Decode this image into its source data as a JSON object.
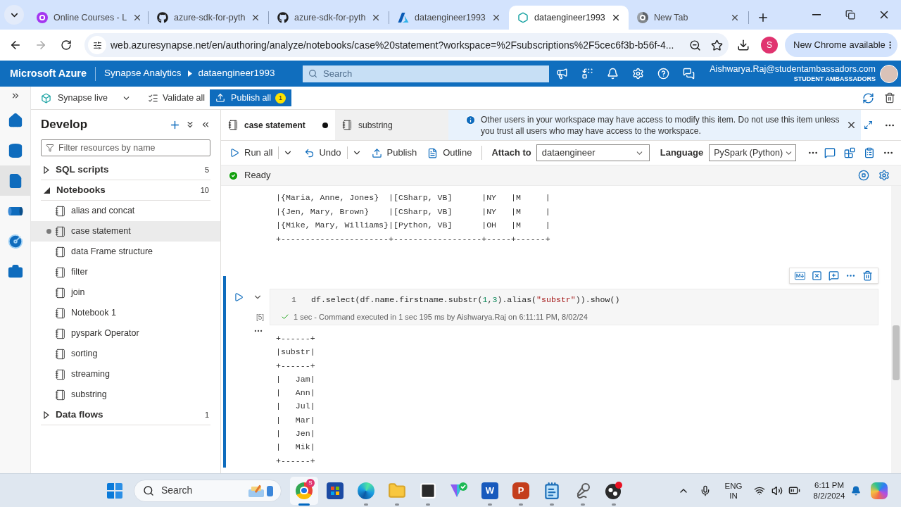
{
  "browser": {
    "tabs": [
      {
        "kind": "courses",
        "title": "Online Courses - L",
        "selected": false
      },
      {
        "kind": "github",
        "title": "azure-sdk-for-pyth",
        "selected": false
      },
      {
        "kind": "github",
        "title": "azure-sdk-for-pyth",
        "selected": false
      },
      {
        "kind": "azure",
        "title": "dataengineer1993",
        "selected": false
      },
      {
        "kind": "synapse",
        "title": "dataengineer1993",
        "selected": true
      },
      {
        "kind": "newtab",
        "title": "New Tab",
        "selected": false
      }
    ],
    "nav": {
      "back_disabled": false,
      "forward_disabled": true
    },
    "url": "web.azuresynapse.net/en/authoring/analyze/notebooks/case%20statement?workspace=%2Fsubscriptions%2F5cec6f3b-b56f-4...",
    "profile_initial": "S",
    "update_button": "New Chrome available"
  },
  "portal_header": {
    "brand": "Microsoft Azure",
    "breadcrumb": [
      "Synapse Analytics",
      "dataengineer1993"
    ],
    "search": {
      "placeholder": "Search"
    },
    "user_email": "Aishwarya.Raj@studentambassadors.com",
    "user_org": "STUDENT AMBASSADORS"
  },
  "command_bar": {
    "mode": "Synapse live",
    "validate": "Validate all",
    "publish": "Publish all",
    "publish_count": "1"
  },
  "activity_rail": [
    {
      "kind": "home",
      "selected": false
    },
    {
      "kind": "data",
      "selected": false
    },
    {
      "kind": "develop",
      "selected": true
    },
    {
      "kind": "integrate",
      "selected": false
    },
    {
      "kind": "monitor",
      "selected": false
    },
    {
      "kind": "manage",
      "selected": false
    }
  ],
  "sidebar": {
    "title": "Develop",
    "filter": {
      "placeholder": "Filter resources by name"
    },
    "tree": [
      {
        "label": "SQL scripts",
        "count": "5",
        "expanded": false
      },
      {
        "label": "Notebooks",
        "count": "10",
        "expanded": true,
        "children": [
          {
            "label": "alias and concat",
            "selected": false,
            "unsaved": false
          },
          {
            "label": "case statement",
            "selected": true,
            "unsaved": true
          },
          {
            "label": "data Frame structure",
            "selected": false,
            "unsaved": false
          },
          {
            "label": "filter",
            "selected": false,
            "unsaved": false
          },
          {
            "label": "join",
            "selected": false,
            "unsaved": false
          },
          {
            "label": "Notebook 1",
            "selected": false,
            "unsaved": false
          },
          {
            "label": "pyspark Operator",
            "selected": false,
            "unsaved": false
          },
          {
            "label": "sorting",
            "selected": false,
            "unsaved": false
          },
          {
            "label": "streaming",
            "selected": false,
            "unsaved": false
          },
          {
            "label": "substring",
            "selected": false,
            "unsaved": false
          }
        ]
      },
      {
        "label": "Data flows",
        "count": "1",
        "expanded": false
      }
    ]
  },
  "editor_tabs": [
    {
      "label": "case statement",
      "selected": true,
      "unsaved": true
    },
    {
      "label": "substring",
      "selected": false,
      "unsaved": false
    }
  ],
  "notice": {
    "message": "Other users in your workspace may have access to modify this item. Do not use this item unless you trust all users who may have access to the workspace."
  },
  "notebook_toolbar": {
    "run_all": "Run all",
    "undo": "Undo",
    "publish": "Publish",
    "outline": "Outline",
    "attach_to": {
      "label": "Attach to",
      "value": "dataengineer"
    },
    "language": {
      "label": "Language",
      "value": "PySpark (Python)"
    }
  },
  "session": {
    "status": "Ready"
  },
  "previous_output": [
    "|{Maria, Anne, Jones}  |[CSharp, VB]      |NY   |M     |",
    "|{Jen, Mary, Brown}    |[CSharp, VB]      |NY   |M     |",
    "|{Mike, Mary, Williams}|[Python, VB]      |OH   |M     |",
    "+----------------------+------------------+-----+------+"
  ],
  "cell": {
    "execution_count": "[5]",
    "line_number": "1",
    "code": [
      {
        "kind": "plain",
        "text": "df.select(df.name.firstname.substr("
      },
      {
        "kind": "number",
        "text": "1"
      },
      {
        "kind": "plain",
        "text": ","
      },
      {
        "kind": "number",
        "text": "3"
      },
      {
        "kind": "plain",
        "text": ").alias("
      },
      {
        "kind": "string",
        "text": "\"substr\""
      },
      {
        "kind": "plain",
        "text": ")).show()"
      }
    ],
    "run_status": "1 sec - Command executed in 1 sec 195 ms by Aishwarya.Raj on 6:11:11 PM, 8/02/24",
    "output": [
      "+------+",
      "|substr|",
      "+------+",
      "|   Jam|",
      "|   Ann|",
      "|   Jul|",
      "|   Mar|",
      "|   Jen|",
      "|   Mik|",
      "+------+"
    ]
  },
  "taskbar": {
    "search": {
      "placeholder": "Search"
    },
    "apps": [
      {
        "kind": "chrome",
        "badge": "S",
        "running": true,
        "selected": true
      },
      {
        "kind": "store",
        "running": false,
        "selected": false
      },
      {
        "kind": "edge",
        "running": true,
        "selected": false
      },
      {
        "kind": "files",
        "running": true,
        "selected": false
      },
      {
        "kind": "terminal",
        "running": true,
        "selected": false
      },
      {
        "kind": "vpn",
        "running": false,
        "selected": false
      },
      {
        "kind": "word",
        "glyph": "W",
        "running": true,
        "selected": false
      },
      {
        "kind": "powerpoint",
        "glyph": "P",
        "running": true,
        "selected": false
      },
      {
        "kind": "notepad",
        "running": true,
        "selected": false
      },
      {
        "kind": "recorder",
        "running": true,
        "selected": false
      },
      {
        "kind": "obs",
        "running": true,
        "selected": false
      }
    ],
    "input_language": "ENG",
    "input_region": "IN",
    "time": "6:11 PM",
    "date": "8/2/2024"
  }
}
